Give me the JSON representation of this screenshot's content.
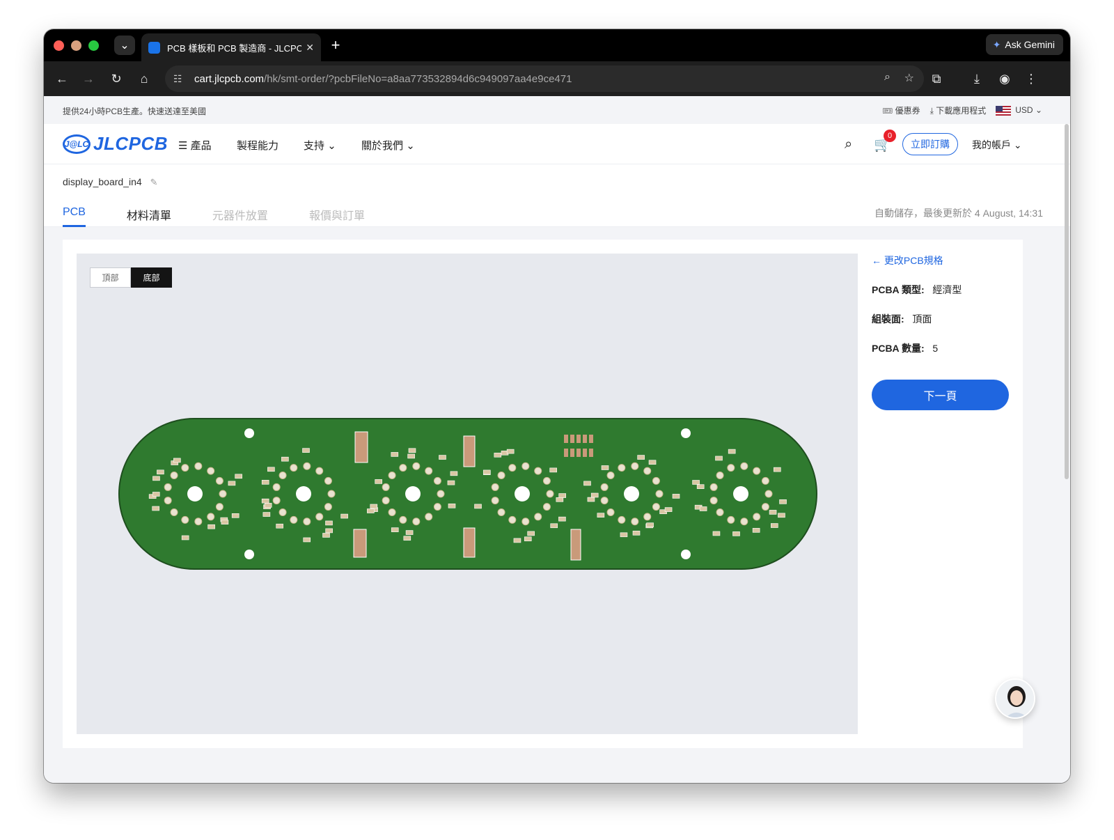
{
  "browser": {
    "tab_title": "PCB 樣板和 PCB 製造商 - JLCPCB",
    "url_host": "cart.jlcpcb.com",
    "url_path": "/hk/smt-order/?pcbFileNo=a8aa773532894d6c949097aa4e9ce471",
    "gemini_label": "Ask Gemini"
  },
  "topbar": {
    "promo": "提供24小時PCB生產。快速送達至美國",
    "coupon": "優惠券",
    "download_app": "下載應用程式",
    "currency": "USD"
  },
  "nav": {
    "logo_badge": "J@LC",
    "logo_text": "JLCPCB",
    "products": "產品",
    "capabilities": "製程能力",
    "support": "支持",
    "about": "關於我們",
    "cart_count": "0",
    "order_now": "立即訂購",
    "account": "我的帳戶"
  },
  "project": {
    "filename": "display_board_in4",
    "tabs": [
      "PCB",
      "材料清單",
      "元器件放置",
      "報價與訂單"
    ],
    "autosave": "自動儲存，最後更新於 4 August, 14:31"
  },
  "viewer": {
    "top_label": "頂部",
    "bottom_label": "底部",
    "selected": "底部",
    "board_color": "#2f7a2f"
  },
  "panel": {
    "back_link": "更改PCB規格",
    "specs": [
      {
        "key": "PCBA 類型:",
        "value": "經濟型"
      },
      {
        "key": "組裝面:",
        "value": "頂面"
      },
      {
        "key": "PCBA 數量:",
        "value": "5"
      }
    ],
    "next_button": "下一頁"
  },
  "colors": {
    "accent": "#1f66e0",
    "badge": "#e8212b",
    "pcb_green": "#2f7a2f"
  }
}
